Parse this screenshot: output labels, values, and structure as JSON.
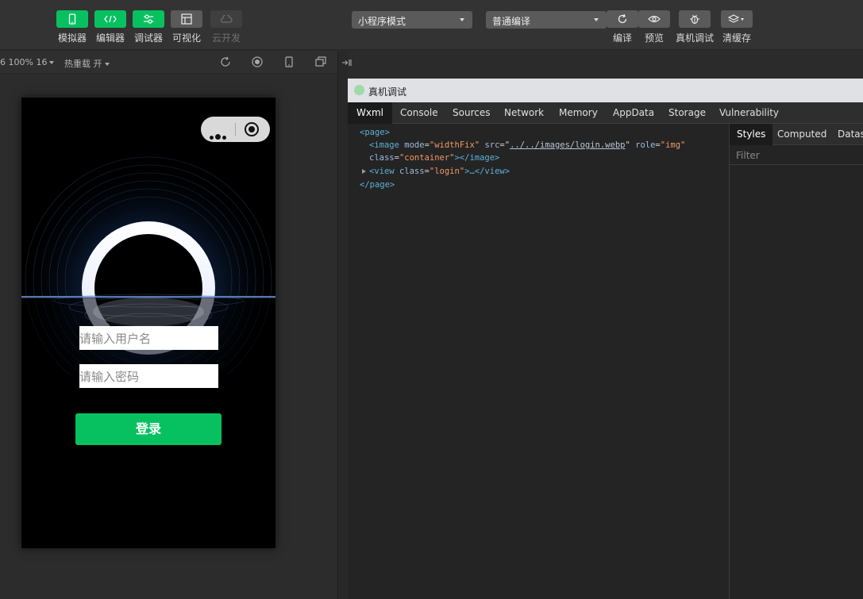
{
  "toolbar": {
    "left_buttons": [
      {
        "label": "模拟器",
        "icon": "phone-icon"
      },
      {
        "label": "编辑器",
        "icon": "code-icon"
      },
      {
        "label": "调试器",
        "icon": "debug-icon"
      },
      {
        "label": "可视化",
        "icon": "layout-icon"
      },
      {
        "label": "云开发",
        "icon": "cloud-icon"
      }
    ],
    "mode_select": "小程序模式",
    "compile_select": "普通编译",
    "right_buttons": [
      {
        "label": "编译",
        "icon": "refresh-icon"
      },
      {
        "label": "预览",
        "icon": "eye-icon"
      },
      {
        "label": "真机调试",
        "icon": "bug-icon"
      },
      {
        "label": "清缓存",
        "icon": "layers-icon"
      }
    ]
  },
  "simulator_bar": {
    "device_zoom": "6 100% 16",
    "hot_reload": "热重载 开"
  },
  "phone": {
    "username_placeholder": "请输入用户名",
    "password_placeholder": "请输入密码",
    "login_label": "登录"
  },
  "devtools": {
    "title": "真机调试",
    "tabs": [
      "Wxml",
      "Console",
      "Sources",
      "Network",
      "Memory",
      "AppData",
      "Storage",
      "Vulnerability"
    ],
    "active_tab": "Wxml",
    "code": {
      "line1_tag": "<page>",
      "image_open": "<image",
      "attr_mode": "mode",
      "val_mode": "\"widthFix\"",
      "attr_src": "src",
      "val_src": "../../images/login.webp",
      "attr_role": "role",
      "val_role": "\"img\"",
      "attr_class": "class",
      "val_class": "\"container\"",
      "image_close": "></image>",
      "view_open": "<view",
      "view_class_val": "\"login\"",
      "view_rest": ">…</view>",
      "page_close": "</page>"
    },
    "side_tabs": [
      "Styles",
      "Computed",
      "Dataset"
    ],
    "filter_placeholder": "Filter"
  }
}
